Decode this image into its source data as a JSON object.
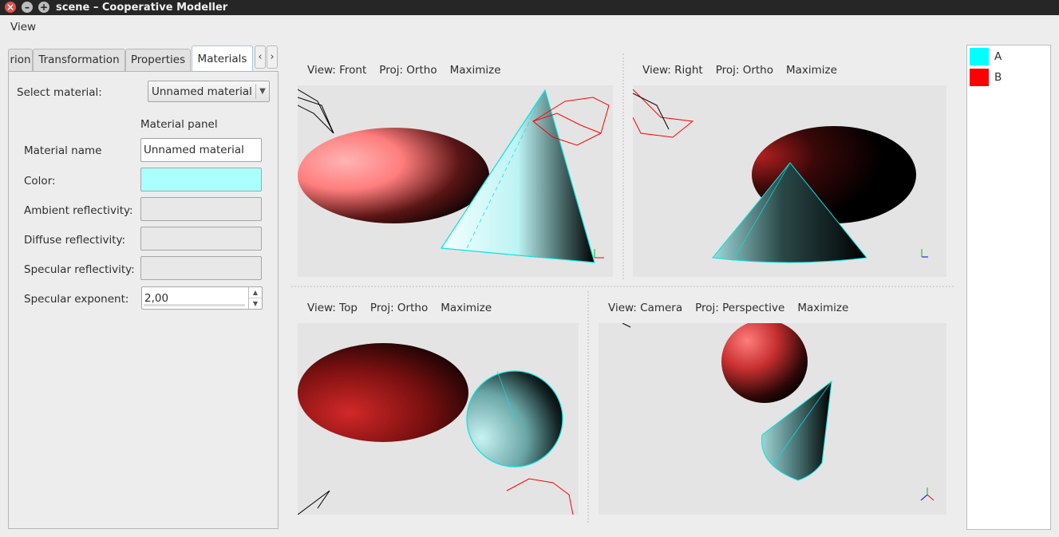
{
  "window": {
    "title": "scene – Cooperative Modeller"
  },
  "menu": {
    "items": [
      "View"
    ]
  },
  "tabs": [
    {
      "label": "rion"
    },
    {
      "label": "Transformation"
    },
    {
      "label": "Properties"
    },
    {
      "label": "Materials"
    }
  ],
  "materials": {
    "select_label": "Select material:",
    "selected_material": "Unnamed material",
    "panel_title": "Material panel",
    "name_label": "Material name",
    "name_value": "Unnamed material",
    "color_label": "Color:",
    "color_value": "#aaffff",
    "ambient_label": "Ambient reflectivity:",
    "diffuse_label": "Diffuse reflectivity:",
    "specular_label": "Specular reflectivity:",
    "exponent_label": "Specular exponent:",
    "exponent_value": "2,00"
  },
  "viewports": [
    {
      "view": "View: Front",
      "proj": "Proj: Ortho",
      "action": "Maximize"
    },
    {
      "view": "View: Right",
      "proj": "Proj: Ortho",
      "action": "Maximize"
    },
    {
      "view": "View: Top",
      "proj": "Proj: Ortho",
      "action": "Maximize"
    },
    {
      "view": "View: Camera",
      "proj": "Proj: Perspective",
      "action": "Maximize"
    }
  ],
  "legend": [
    {
      "name": "A",
      "color": "#00ffff"
    },
    {
      "name": "B",
      "color": "#ff0000"
    }
  ]
}
